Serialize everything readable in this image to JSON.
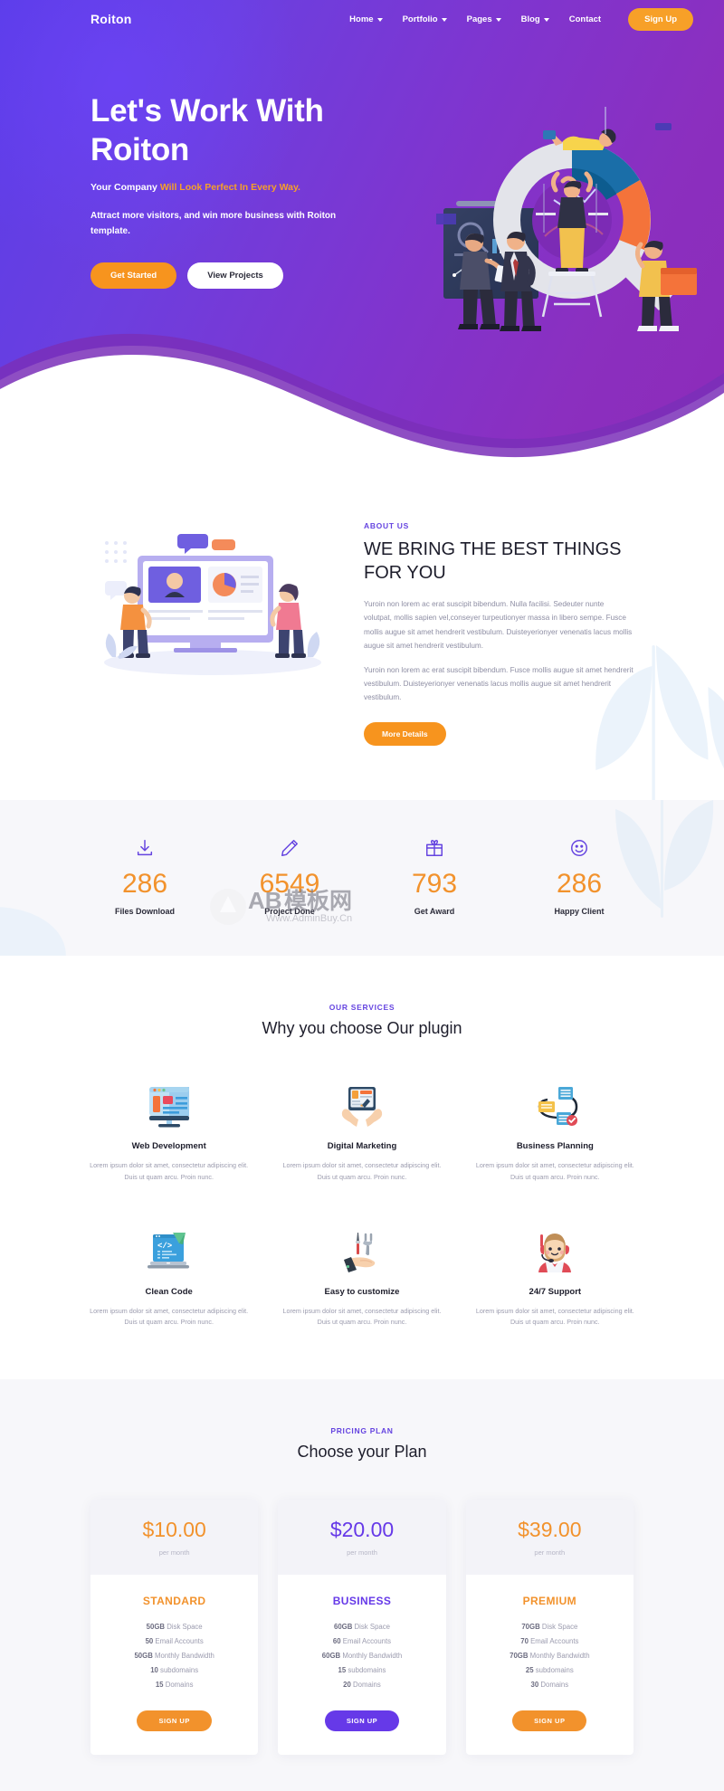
{
  "brand": "Roiton",
  "nav": {
    "items": [
      {
        "label": "Home",
        "caret": true
      },
      {
        "label": "Portfolio",
        "caret": true
      },
      {
        "label": "Pages",
        "caret": true
      },
      {
        "label": "Blog",
        "caret": true
      },
      {
        "label": "Contact",
        "caret": false
      }
    ],
    "signup_label": "Sign Up"
  },
  "hero": {
    "title_line1": "Let's Work With",
    "title_line2": "Roiton",
    "sub_lead": "Your Company ",
    "sub_accent": "Will Look Perfect In Every Way.",
    "description": "Attract more visitors, and win more business with Roiton template.",
    "btn_primary": "Get Started",
    "btn_secondary": "View Projects"
  },
  "about": {
    "eyebrow": "ABOUT US",
    "heading": "WE BRING THE BEST THINGS FOR YOU",
    "paragraph1": "Yuroin non lorem ac erat suscipit bibendum. Nulla facilisi. Sedeuter nunte volutpat, mollis sapien vel,conseyer turpeutionyer massa in libero sempe. Fusce mollis augue sit amet hendrerit vestibulum. Duisteyerionyer venenatis lacus mollis augue sit amet hendrerit vestibulum.",
    "paragraph2": "Yuroin non lorem ac erat suscipit bibendum. Fusce mollis augue sit amet hendrerit vestibulum. Duisteyerionyer venenatis lacus mollis augue sit amet hendrerit vestibulum.",
    "btn_label": "More Details"
  },
  "counters": {
    "accent_color": "#f2922c",
    "items": [
      {
        "icon": "download-icon",
        "value": "286",
        "label": "Files Download"
      },
      {
        "icon": "pencil-icon",
        "value": "6549",
        "label": "Project Done"
      },
      {
        "icon": "gift-icon",
        "value": "793",
        "label": "Get Award"
      },
      {
        "icon": "smile-icon",
        "value": "286",
        "label": "Happy Client"
      }
    ],
    "watermark_text": "AB模板网",
    "watermark_sub": "Www.AdminBuy.Cn"
  },
  "services": {
    "eyebrow": "OUR SERVICES",
    "title": "Why you choose Our plugin",
    "items": [
      {
        "icon": "monitor-web-icon",
        "title": "Web Development",
        "desc": "Lorem ipsum dolor sit amet, consectetur adipiscing elit. Duis ut quam arcu. Proin nunc."
      },
      {
        "icon": "tablet-hands-icon",
        "title": "Digital Marketing",
        "desc": "Lorem ipsum dolor sit amet, consectetur adipiscing elit. Duis ut quam arcu. Proin nunc."
      },
      {
        "icon": "flowchart-icon",
        "title": "Business Planning",
        "desc": "Lorem ipsum dolor sit amet, consectetur adipiscing elit. Duis ut quam arcu. Proin nunc."
      },
      {
        "icon": "laptop-code-icon",
        "title": "Clean Code",
        "desc": "Lorem ipsum dolor sit amet, consectetur adipiscing elit. Duis ut quam arcu. Proin nunc."
      },
      {
        "icon": "hand-tools-icon",
        "title": "Easy to customize",
        "desc": "Lorem ipsum dolor sit amet, consectetur adipiscing elit. Duis ut quam arcu. Proin nunc."
      },
      {
        "icon": "support-agent-icon",
        "title": "24/7 Support",
        "desc": "Lorem ipsum dolor sit amet, consectetur adipiscing elit. Duis ut quam arcu. Proin nunc."
      }
    ]
  },
  "pricing": {
    "eyebrow": "PRICING PLAN",
    "title": "Choose your Plan",
    "plans": [
      {
        "amount": "$10.00",
        "period": "per month",
        "name": "STANDARD",
        "accent": "#f2922c",
        "features": [
          {
            "strong": "50GB",
            "rest": " Disk Space"
          },
          {
            "strong": "50",
            "rest": " Email Accounts"
          },
          {
            "strong": "50GB",
            "rest": " Monthly Bandwidth"
          },
          {
            "strong": "10",
            "rest": " subdomains"
          },
          {
            "strong": "15",
            "rest": " Domains"
          }
        ],
        "btn_label": "SIGN UP"
      },
      {
        "amount": "$20.00",
        "period": "per month",
        "name": "BUSINESS",
        "accent": "#6639e8",
        "features": [
          {
            "strong": "60GB",
            "rest": " Disk Space"
          },
          {
            "strong": "60",
            "rest": " Email Accounts"
          },
          {
            "strong": "60GB",
            "rest": " Monthly Bandwidth"
          },
          {
            "strong": "15",
            "rest": " subdomains"
          },
          {
            "strong": "20",
            "rest": " Domains"
          }
        ],
        "btn_label": "SIGN UP"
      },
      {
        "amount": "$39.00",
        "period": "per month",
        "name": "PREMIUM",
        "accent": "#f2922c",
        "features": [
          {
            "strong": "70GB",
            "rest": " Disk Space"
          },
          {
            "strong": "70",
            "rest": " Email Accounts"
          },
          {
            "strong": "70GB",
            "rest": " Monthly Bandwidth"
          },
          {
            "strong": "25",
            "rest": " subdomains"
          },
          {
            "strong": "30",
            "rest": " Domains"
          }
        ],
        "btn_label": "SIGN UP"
      }
    ]
  }
}
